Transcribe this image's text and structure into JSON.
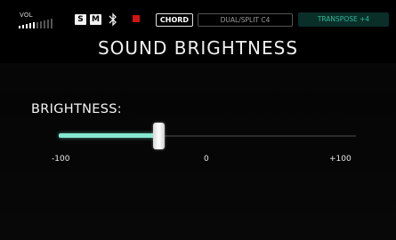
{
  "status_bar": {
    "vol_label": "VOL",
    "vol_level": 5,
    "vol_steps": 10,
    "s_label": "S",
    "m_label": "M",
    "bluetooth_icon": "bluetooth-icon",
    "record_icon": "record-icon",
    "chord_label": "CHORD",
    "dual_split_label": "DUAL/SPLIT C4",
    "transpose_label": "TRANSPOSE +4"
  },
  "page": {
    "title": "SOUND BRIGHTNESS"
  },
  "parameter": {
    "label": "BRIGHTNESS:",
    "min_label": "-100",
    "mid_label": "0",
    "max_label": "+100",
    "min": -100,
    "max": 100,
    "value": -33
  },
  "colors": {
    "accent": "#86e8d0",
    "transpose_text": "#2fb89b",
    "record": "#d21414"
  }
}
